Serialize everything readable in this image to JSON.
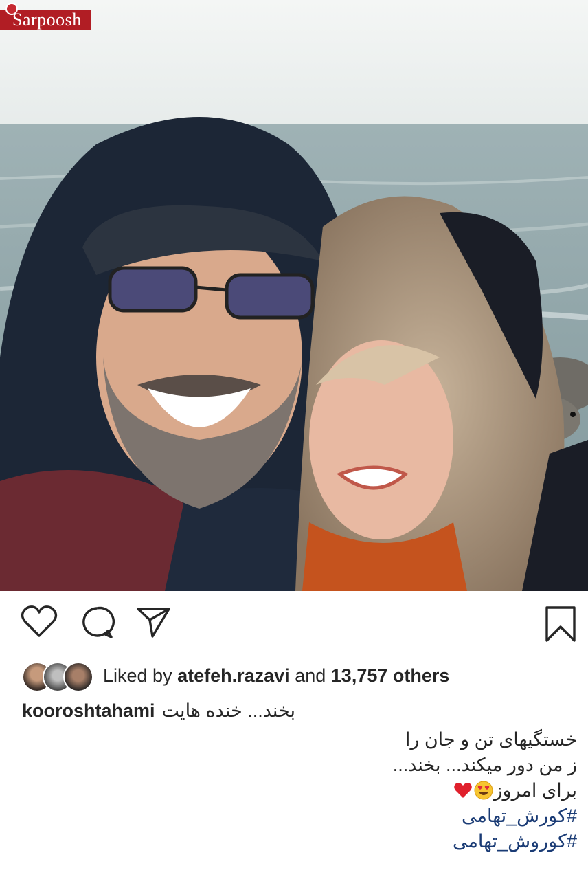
{
  "watermark": {
    "text": "Sarpoosh"
  },
  "post": {
    "icons": {
      "like": "heart-outline-icon",
      "comment": "comment-bubble-icon",
      "share": "paper-plane-icon",
      "save": "bookmark-icon"
    },
    "likes": {
      "prefix": "Liked by",
      "user": "atefeh.razavi",
      "conj": "and",
      "count": "13,757",
      "suffix": "others"
    },
    "caption": {
      "username": "kooroshtahami",
      "first_line": "بخند... خنده هایت",
      "lines": [
        "خستگیهای تن و جان را",
        "ز من دور میکند... بخند...",
        "برای امروز"
      ],
      "emojis": [
        "heart-eyes-emoji",
        "red-heart-emoji"
      ],
      "hashtags": [
        "#کورش_تهامی",
        "#کوروش_تهامی"
      ]
    }
  }
}
